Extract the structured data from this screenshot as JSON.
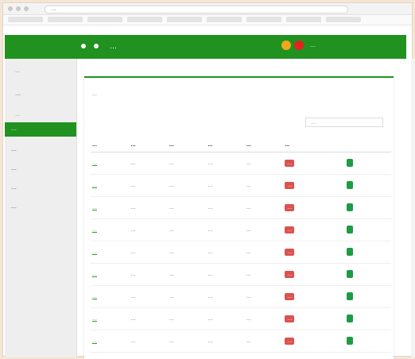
{
  "browser": {
    "url": "…"
  },
  "navbar": {
    "title": "…",
    "user": "…"
  },
  "sidebar": {
    "user_name": "…",
    "user_title": "…",
    "ghost_item": "…",
    "active_item": "…",
    "items": [
      "…",
      "…",
      "…",
      "…"
    ]
  },
  "card": {
    "title": "…",
    "search_label": "…"
  },
  "table": {
    "headers": [
      "…",
      "…",
      "…",
      "…",
      "…",
      "…"
    ],
    "badge": "…",
    "rows": [
      [
        "…",
        "…",
        "…",
        "…",
        "…"
      ],
      [
        "…",
        "…",
        "…",
        "…",
        "…"
      ],
      [
        "…",
        "…",
        "…",
        "…",
        "…"
      ],
      [
        "…",
        "…",
        "…",
        "…",
        "…"
      ],
      [
        "…",
        "…",
        "…",
        "…",
        "…"
      ],
      [
        "…",
        "…",
        "…",
        "…",
        "…"
      ],
      [
        "…",
        "…",
        "…",
        "…",
        "…"
      ],
      [
        "…",
        "…",
        "…",
        "…",
        "…"
      ],
      [
        "…",
        "…",
        "…",
        "…",
        "…"
      ]
    ]
  },
  "colors": {
    "nav": "#21921f",
    "badge": "#d9534f",
    "action": "#1e9b45"
  }
}
